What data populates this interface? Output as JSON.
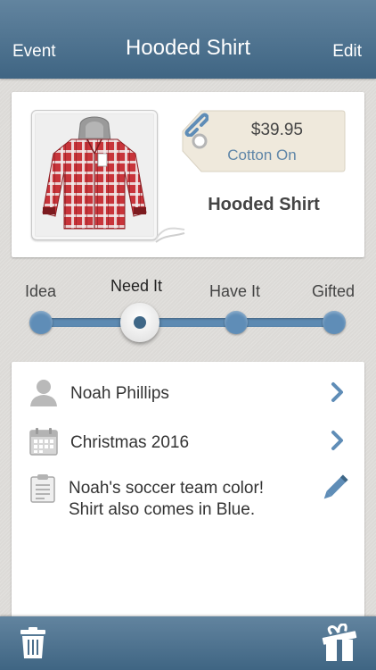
{
  "nav": {
    "back_label": "Event",
    "title": "Hooded Shirt",
    "edit_label": "Edit"
  },
  "item": {
    "name": "Hooded Shirt",
    "price": "$39.95",
    "store": "Cotton On",
    "image_icon": "red-plaid-hooded-shirt-photo"
  },
  "status": {
    "options": [
      "Idea",
      "Need It",
      "Have It",
      "Gifted"
    ],
    "selected": "Need It",
    "selected_index": 1
  },
  "details": {
    "recipient": "Noah Phillips",
    "event": "Christmas 2016",
    "note_lines": [
      "Noah's soccer team color!",
      "Shirt also comes in Blue."
    ]
  },
  "colors": {
    "nav_blue": "#4f7491",
    "accent_blue": "#5f8db7",
    "icon_gray": "#b9b9b9"
  },
  "icons": {
    "link": "link-icon",
    "person": "person-icon",
    "calendar": "calendar-icon",
    "note": "notepad-icon",
    "chevron": "chevron-right-icon",
    "edit": "pencil-icon",
    "delete": "trash-icon",
    "gift": "gift-box-icon"
  }
}
